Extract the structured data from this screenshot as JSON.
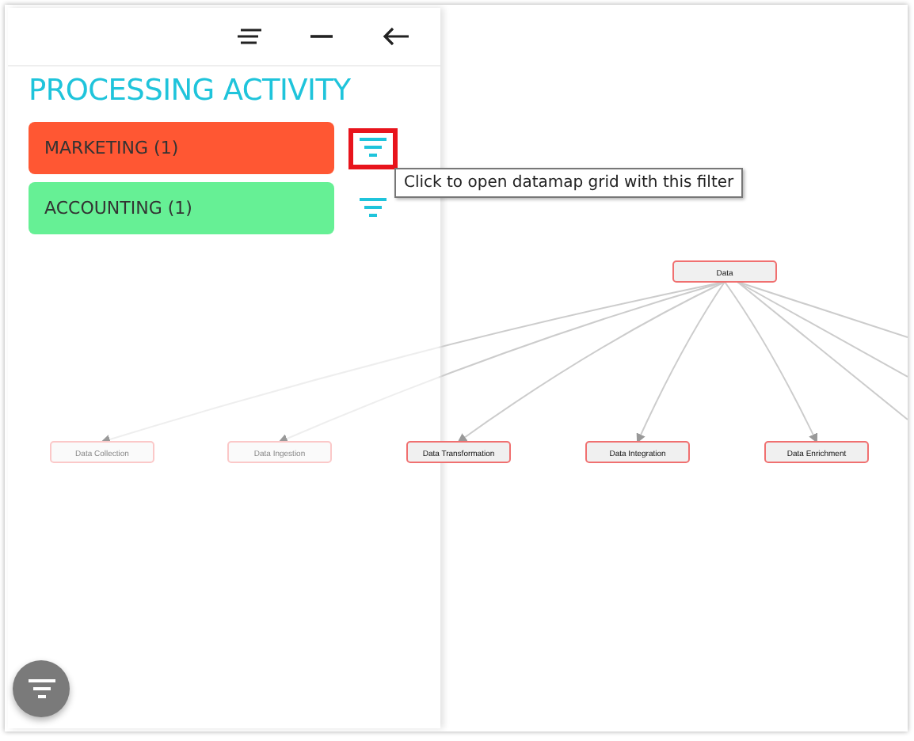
{
  "panel": {
    "title": "PROCESSING ACTIVITY",
    "items": [
      {
        "label": "MARKETING (1)",
        "color": "#ff5733",
        "focused": true
      },
      {
        "label": "ACCOUNTING (1)",
        "color": "#66f095",
        "focused": false
      }
    ],
    "tooltip": "Click to open datamap grid with this filter"
  },
  "graph": {
    "root": "Data",
    "nodes": [
      {
        "label": "Data Collection"
      },
      {
        "label": "Data Ingestion"
      },
      {
        "label": "Data Transformation"
      },
      {
        "label": "Data Integration"
      },
      {
        "label": "Data Enrichment"
      }
    ]
  }
}
